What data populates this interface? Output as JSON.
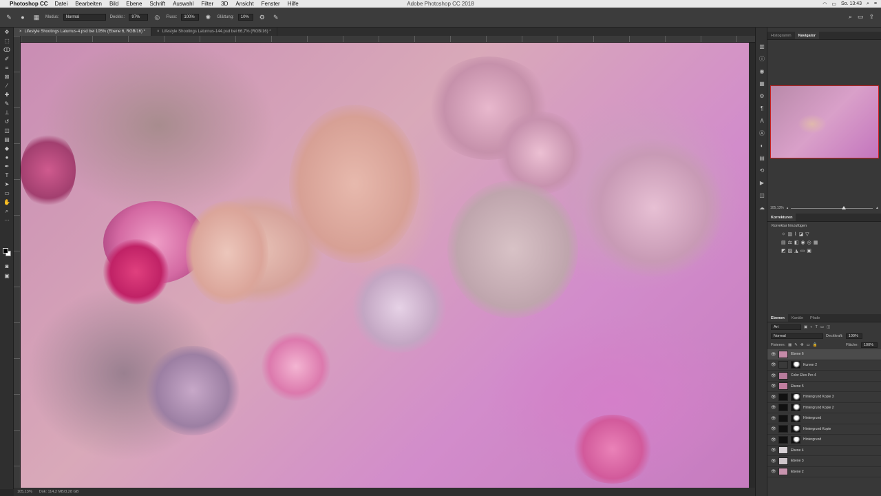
{
  "menubar": {
    "app_name": "Photoshop CC",
    "items": [
      "Datei",
      "Bearbeiten",
      "Bild",
      "Ebene",
      "Schrift",
      "Auswahl",
      "Filter",
      "3D",
      "Ansicht",
      "Fenster",
      "Hilfe"
    ],
    "window_title": "Adobe Photoshop CC 2018",
    "clock": "So. 13:43"
  },
  "options": {
    "mode_label": "Modus:",
    "mode_value": "Normal",
    "opacity_label": "Deckkr.:",
    "opacity_value": "97%",
    "flow_label": "Fluss:",
    "flow_value": "100%",
    "smoothing_label": "Glättung:",
    "smoothing_value": "10%"
  },
  "tabs": [
    {
      "label": "Lifestyle Shootings Laturnus-4.psd bei 105% (Ebene 6, RGB/16) *"
    },
    {
      "label": "Lifestyle Shootings Laturnus-144.psd bei 66,7% (RGB/16) *"
    }
  ],
  "status": {
    "zoom": "105,13%",
    "doc": "Dok: 114,2 MB/3,28 GB"
  },
  "panels": {
    "top_tabs": [
      "Histogramm",
      "Navigator"
    ],
    "navigator_zoom": "105,13%",
    "corrections_tab": "Korrekturen",
    "corrections_label": "Korrektur hinzufügen",
    "layers_tabs": [
      "Ebenen",
      "Kanäle",
      "Pfade"
    ],
    "layers_filter": "Art",
    "blend_mode": "Normal",
    "opacity_label": "Deckkraft:",
    "opacity_value": "100%",
    "lock_label": "Fixieren:",
    "fill_label": "Fläche:",
    "fill_value": "100%",
    "layers": [
      {
        "name": "Ebene 6",
        "thumb": "#c58aa8",
        "mask": false,
        "active": true
      },
      {
        "name": "Kurven 2",
        "thumb": "#3a3a3a",
        "mask": true,
        "active": false
      },
      {
        "name": "Color Efex Pro 4",
        "thumb": "#b77c9c",
        "mask": false,
        "active": false
      },
      {
        "name": "Ebene 5",
        "thumb": "#c07e9f",
        "mask": false,
        "active": false
      },
      {
        "name": "Hintergrund Kopie 3",
        "thumb": "#111111",
        "mask": true,
        "active": false
      },
      {
        "name": "Hintergrund Kopie 2",
        "thumb": "#111111",
        "mask": true,
        "active": false
      },
      {
        "name": "Hintergrund",
        "thumb": "#111111",
        "mask": true,
        "active": false
      },
      {
        "name": "Hintergrund Kopie",
        "thumb": "#111111",
        "mask": true,
        "active": false
      },
      {
        "name": "Hintergrund",
        "thumb": "#111111",
        "mask": true,
        "active": false
      },
      {
        "name": "Ebene 4",
        "thumb": "#d8d2d6",
        "mask": false,
        "active": false
      },
      {
        "name": "Ebene 3",
        "thumb": "#cfc6cb",
        "mask": false,
        "active": false
      },
      {
        "name": "Ebene 2",
        "thumb": "#c894ae",
        "mask": false,
        "active": false
      }
    ]
  }
}
